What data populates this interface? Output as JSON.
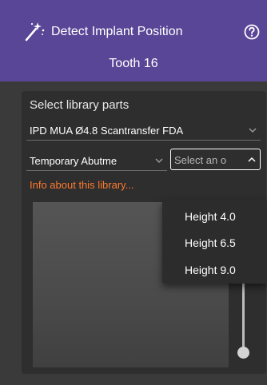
{
  "header": {
    "title": "Detect Implant Position",
    "subtitle": "Tooth 16",
    "wand_icon": "magic-wand-icon",
    "help_icon": "help-circle-icon",
    "background_color": "#5a4696"
  },
  "panel": {
    "section_label": "Select library parts",
    "library_select": {
      "value": "IPD MUA Ø4.8 Scantransfer FDA",
      "icon": "chevron-down-icon"
    },
    "abutment_select": {
      "value": "Temporary Abutme",
      "icon": "chevron-down-icon"
    },
    "height_select": {
      "placeholder": "Select an o",
      "icon": "chevron-up-icon",
      "expanded": true
    },
    "info_link": "Info about this library...",
    "info_link_color": "#ff7a2e"
  },
  "dropdown": {
    "options": [
      {
        "label": "Height 4.0"
      },
      {
        "label": "Height 6.5"
      },
      {
        "label": "Height 9.0"
      }
    ]
  }
}
